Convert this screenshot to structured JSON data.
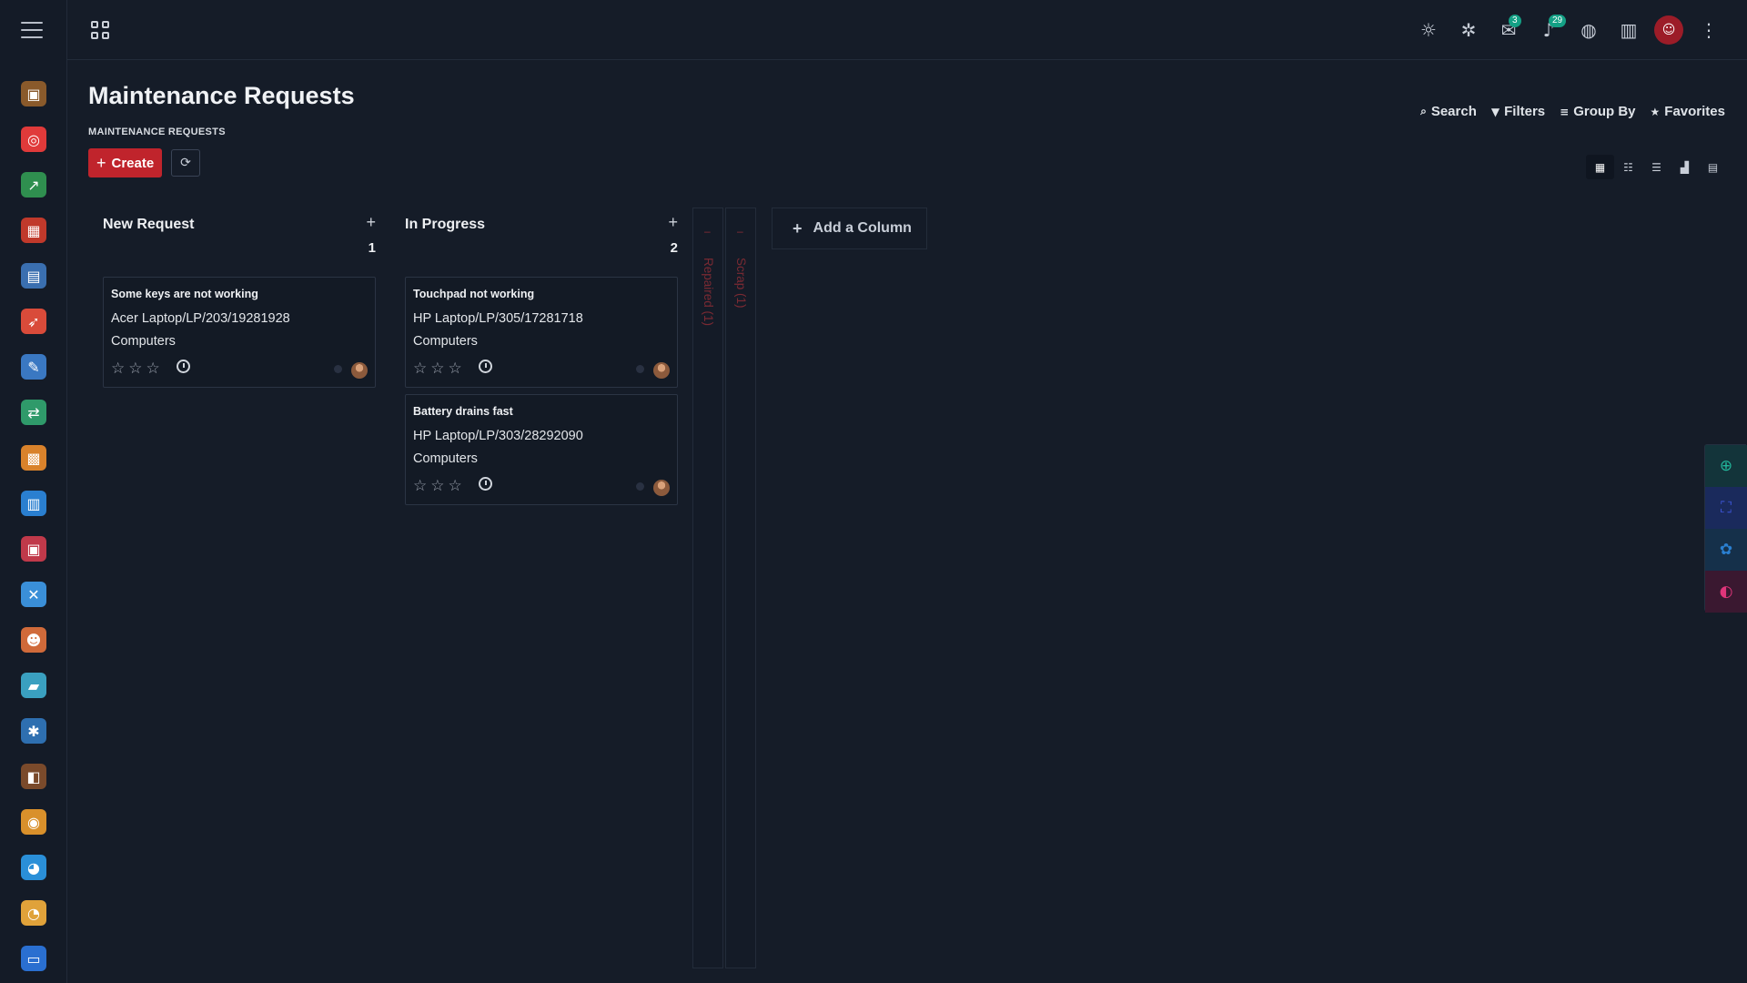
{
  "header": {
    "title": "Maintenance Requests",
    "breadcrumb": "MAINTENANCE REQUESTS",
    "create_label": "Create"
  },
  "topbar": {
    "chat_badge": "3",
    "notification_badge": "29"
  },
  "control_panel": {
    "search_label": "Search",
    "filters_label": "Filters",
    "group_by_label": "Group By",
    "favorites_label": "Favorites"
  },
  "kanban": {
    "columns": [
      {
        "title": "New Request",
        "count": "1",
        "cards": [
          {
            "title": "Some keys are not working",
            "equipment": "Acer Laptop/LP/203/19281928",
            "category": "Computers",
            "priority_stars": 0
          }
        ]
      },
      {
        "title": "In Progress",
        "count": "2",
        "cards": [
          {
            "title": "Touchpad not working",
            "equipment": "HP Laptop/LP/305/17281718",
            "category": "Computers",
            "priority_stars": 0
          },
          {
            "title": "Battery drains fast",
            "equipment": "HP Laptop/LP/303/28292090",
            "category": "Computers",
            "priority_stars": 0
          }
        ]
      }
    ],
    "folded_columns": [
      {
        "label": "Repaired (1)"
      },
      {
        "label": "Scrap (1)"
      }
    ],
    "add_column_label": "Add a Column"
  },
  "sidebar": {
    "app_icons": [
      {
        "icon": "contacts-icon",
        "color": "#8a5a2b",
        "glyph": "▣"
      },
      {
        "icon": "target-icon",
        "color": "#e03a3a",
        "glyph": "◎"
      },
      {
        "icon": "growth-chart-icon",
        "color": "#2f8f4f",
        "glyph": "↗"
      },
      {
        "icon": "store-icon",
        "color": "#c0392b",
        "glyph": "▦"
      },
      {
        "icon": "documents-icon",
        "color": "#3a6fb0",
        "glyph": "▤"
      },
      {
        "icon": "rocket-icon",
        "color": "#d94b3a",
        "glyph": "➶"
      },
      {
        "icon": "notes-icon",
        "color": "#3a78c2",
        "glyph": "✎"
      },
      {
        "icon": "payment-icon",
        "color": "#2f9a6a",
        "glyph": "⇄"
      },
      {
        "icon": "shipping-icon",
        "color": "#d9822b",
        "glyph": "▩"
      },
      {
        "icon": "factory-icon",
        "color": "#2a7fd0",
        "glyph": "▥"
      },
      {
        "icon": "toolbox-icon",
        "color": "#c0394a",
        "glyph": "▣"
      },
      {
        "icon": "maintenance-tools-icon",
        "color": "#3a8fd8",
        "glyph": "✕"
      },
      {
        "icon": "employees-icon",
        "color": "#d06a3a",
        "glyph": "☻"
      },
      {
        "icon": "fleet-icon",
        "color": "#3aa0c0",
        "glyph": "▰"
      },
      {
        "icon": "appraisal-icon",
        "color": "#2e6fb0",
        "glyph": "✱"
      },
      {
        "icon": "wallet-icon",
        "color": "#7a4a2b",
        "glyph": "◧"
      },
      {
        "icon": "lunch-icon",
        "color": "#d9902b",
        "glyph": "◉"
      },
      {
        "icon": "discuss-icon",
        "color": "#2a8fd8",
        "glyph": "◕"
      },
      {
        "icon": "dashboard-icon",
        "color": "#e0a23a",
        "glyph": "◔"
      },
      {
        "icon": "api-icon",
        "color": "#2a6fd0",
        "glyph": "▭"
      }
    ]
  },
  "colors": {
    "accent": "#c0242c",
    "background": "#151c28",
    "badge": "#14a085"
  }
}
